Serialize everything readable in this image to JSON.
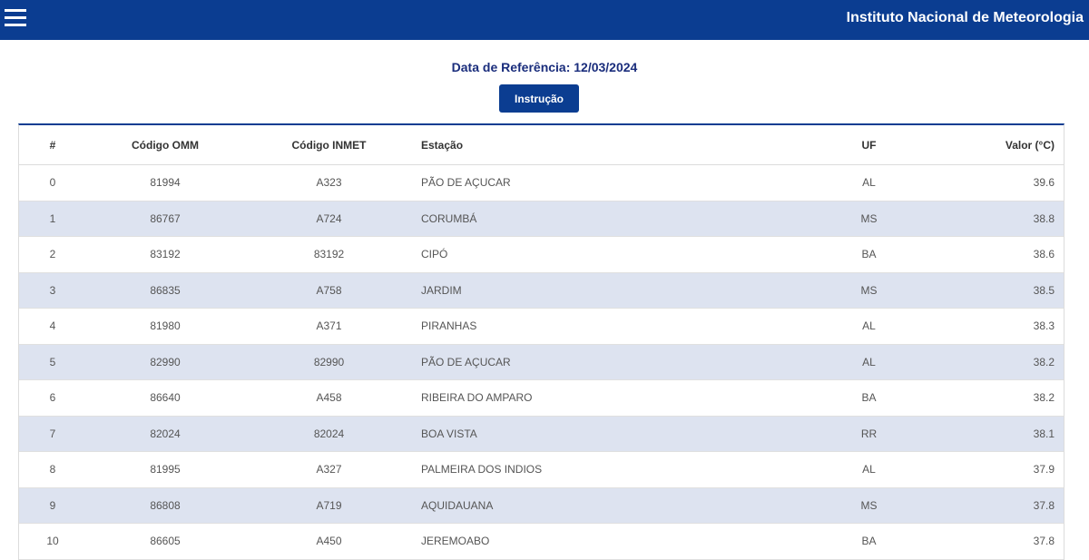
{
  "header": {
    "title": "Instituto Nacional de Meteorologia",
    "menu_icon": "hamburger-menu-icon"
  },
  "main": {
    "reference_date": "Data de Referência: 12/03/2024",
    "instruction_button": "Instrução"
  },
  "table": {
    "columns": [
      "#",
      "Código OMM",
      "Código INMET",
      "Estação",
      "UF",
      "Valor (°C)"
    ],
    "rows": [
      [
        "0",
        "81994",
        "A323",
        "PÃO DE AÇUCAR",
        "AL",
        "39.6"
      ],
      [
        "1",
        "86767",
        "A724",
        "CORUMBÁ",
        "MS",
        "38.8"
      ],
      [
        "2",
        "83192",
        "83192",
        "CIPÓ",
        "BA",
        "38.6"
      ],
      [
        "3",
        "86835",
        "A758",
        "JARDIM",
        "MS",
        "38.5"
      ],
      [
        "4",
        "81980",
        "A371",
        "PIRANHAS",
        "AL",
        "38.3"
      ],
      [
        "5",
        "82990",
        "82990",
        "PÃO DE AÇUCAR",
        "AL",
        "38.2"
      ],
      [
        "6",
        "86640",
        "A458",
        "RIBEIRA DO AMPARO",
        "BA",
        "38.2"
      ],
      [
        "7",
        "82024",
        "82024",
        "BOA VISTA",
        "RR",
        "38.1"
      ],
      [
        "8",
        "81995",
        "A327",
        "PALMEIRA DOS INDIOS",
        "AL",
        "37.9"
      ],
      [
        "9",
        "86808",
        "A719",
        "AQUIDAUANA",
        "MS",
        "37.8"
      ],
      [
        "10",
        "86605",
        "A450",
        "JEREMOABO",
        "BA",
        "37.8"
      ]
    ]
  },
  "colors": {
    "header_bg": "#0b3d91",
    "stripe_row": "#dde3f0",
    "reference_text": "#1a2d7c"
  }
}
